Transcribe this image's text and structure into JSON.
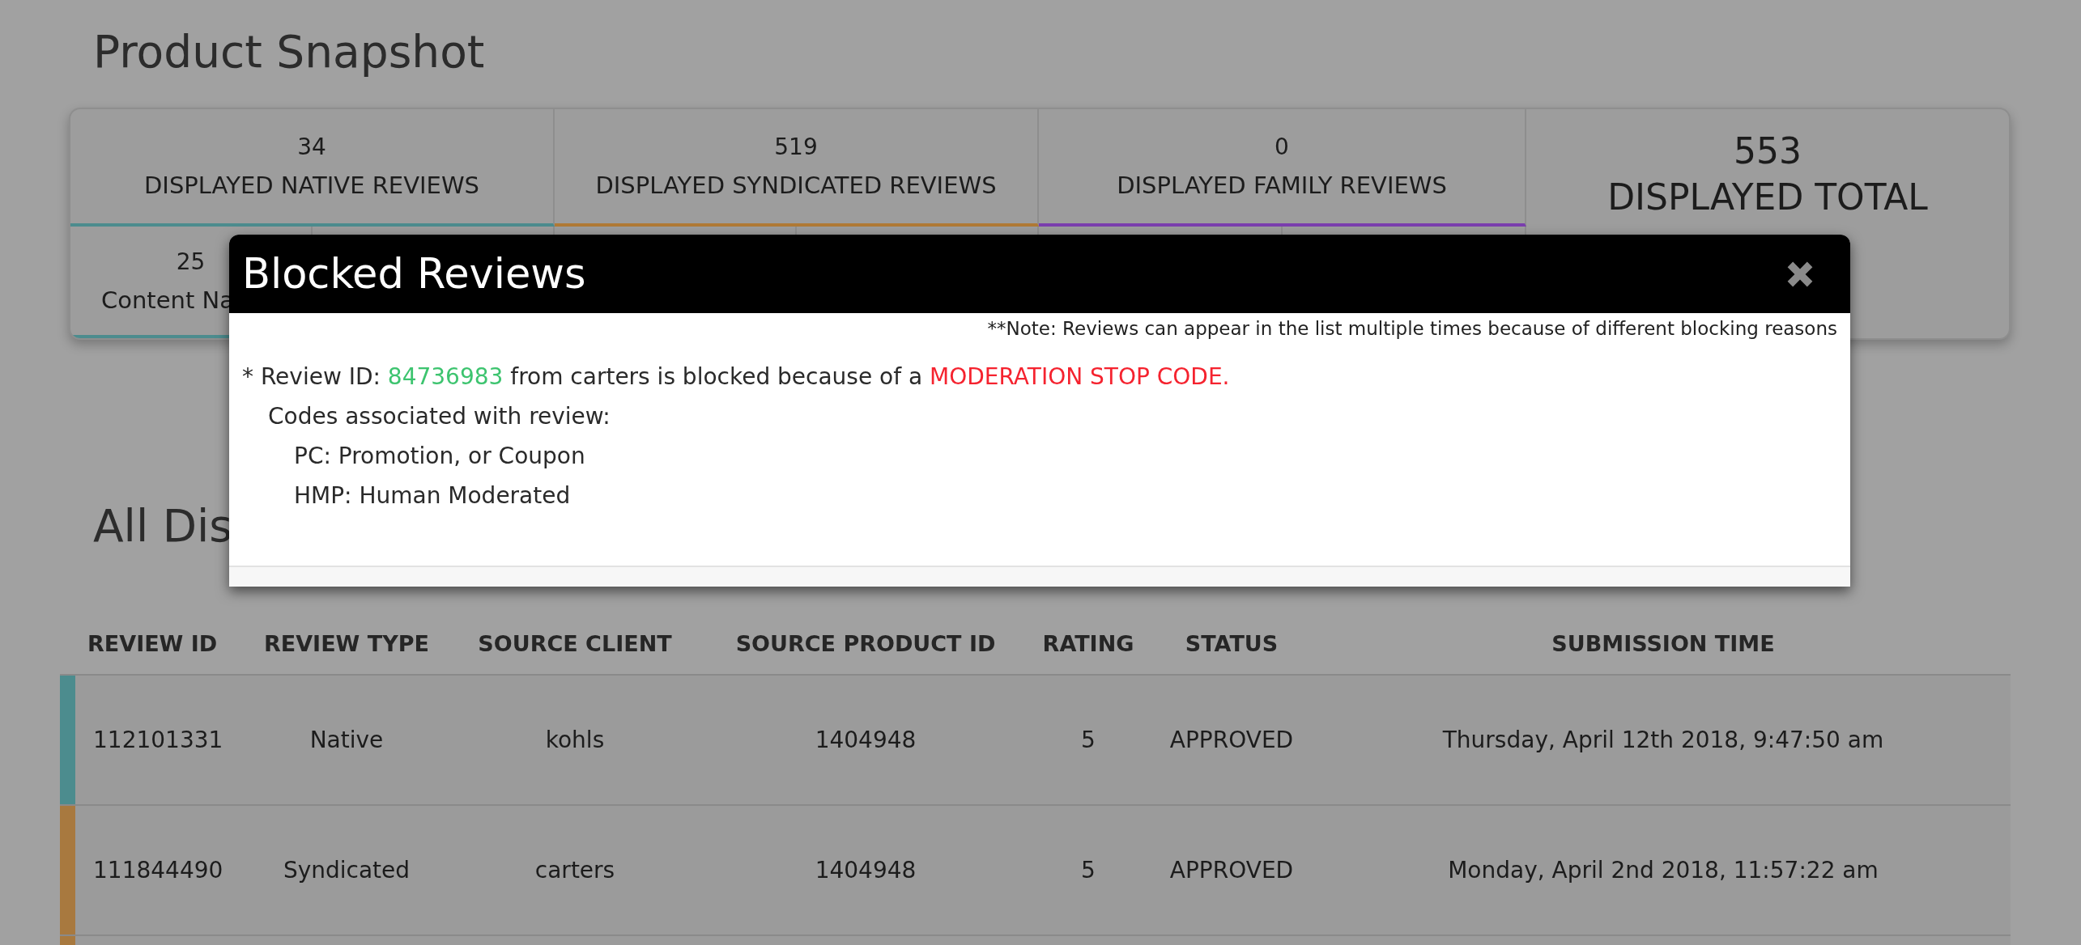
{
  "page_title": "Product Snapshot",
  "snapshot": {
    "cards": [
      {
        "count": "34",
        "label": "DISPLAYED NATIVE REVIEWS",
        "color": "#4c8c8e"
      },
      {
        "count": "519",
        "label": "DISPLAYED SYNDICATED REVIEWS",
        "color": "#b07a36"
      },
      {
        "count": "0",
        "label": "DISPLAYED FAMILY REVIEWS",
        "color": "#7b3fae"
      }
    ],
    "total": {
      "count": "553",
      "label": "DISPLAYED TOTAL"
    },
    "sub_cards": [
      {
        "count": "25",
        "label": "Content Na",
        "color": "#4c8c8e"
      }
    ]
  },
  "section_title": "All Dis",
  "table": {
    "columns": [
      "REVIEW ID",
      "REVIEW TYPE",
      "SOURCE CLIENT",
      "SOURCE PRODUCT ID",
      "RATING",
      "STATUS",
      "SUBMISSION TIME"
    ],
    "rows": [
      {
        "color": "#4c8c8e",
        "cells": [
          "112101331",
          "Native",
          "kohls",
          "1404948",
          "5",
          "APPROVED",
          "Thursday, April 12th 2018, 9:47:50 am"
        ]
      },
      {
        "color": "#a8793f",
        "cells": [
          "111844490",
          "Syndicated",
          "carters",
          "1404948",
          "5",
          "APPROVED",
          "Monday, April 2nd 2018, 11:57:22 am"
        ]
      },
      {
        "color": "#a8793f"
      }
    ]
  },
  "modal": {
    "title": "Blocked Reviews",
    "note": "**Note: Reviews can appear in the list multiple times because of different blocking reasons",
    "reasons": [
      {
        "segments": [
          {
            "kind": "plain",
            "text": "* Review ID: "
          },
          {
            "kind": "id",
            "text": "84736983"
          },
          {
            "kind": "plain",
            "text": " from carters is blocked because of a "
          },
          {
            "kind": "code",
            "text": "MODERATION STOP CODE."
          }
        ],
        "codes_heading": "Codes associated with review:",
        "codes": [
          "PC: Promotion, or Coupon",
          "HMP: Human Moderated"
        ]
      }
    ]
  }
}
